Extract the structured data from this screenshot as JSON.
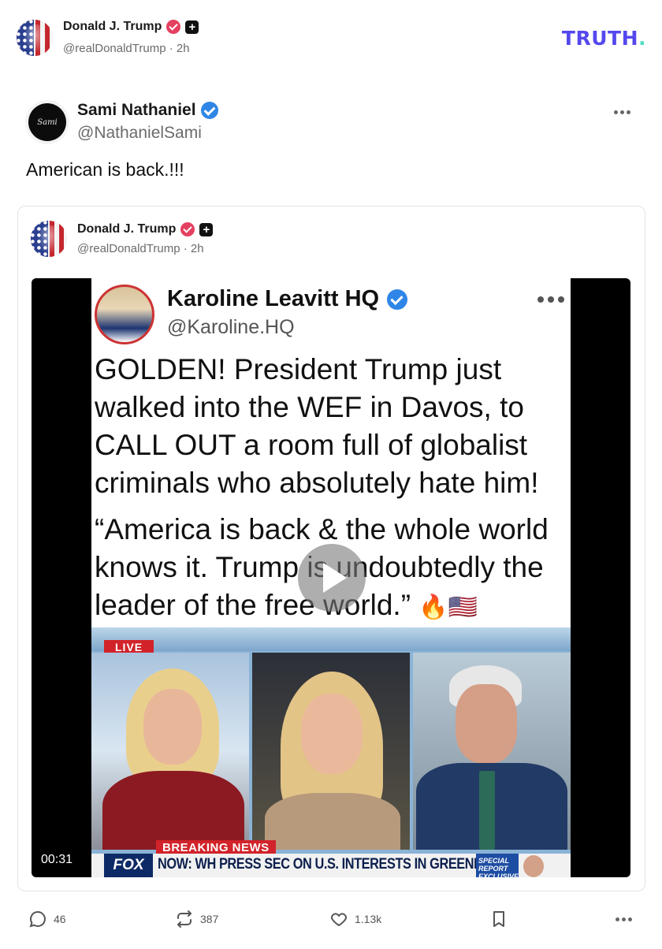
{
  "repost_header": {
    "author_name": "Donald J. Trump",
    "handle": "@realDonaldTrump",
    "time": "2h"
  },
  "brand": {
    "logo_text": "TRUTH",
    "logo_dot": "."
  },
  "post": {
    "author_name": "Sami Nathaniel",
    "avatar_text": "Sami",
    "handle": "@NathanielSami",
    "text": "American is back.!!!"
  },
  "quoted_post": {
    "author_name": "Donald J. Trump",
    "handle": "@realDonaldTrump",
    "time": "2h",
    "video": {
      "duration": "00:31",
      "frame": {
        "account_name": "Karoline Leavitt HQ",
        "account_handle": "@Karoline.HQ",
        "body": "GOLDEN! President Trump just walked into the WEF in Davos, to CALL OUT a room full of globalist criminals who absolutely hate him!",
        "quote": "“America is back & the whole world knows it. Trump is undoubtedly the leader of the free world.”",
        "emoji": "🔥🇺🇸",
        "live_label": "LIVE",
        "breaking_label": "BREAKING NEWS",
        "network": "FOX",
        "ticker": "NOW: WH PRESS SEC ON U.S. INTERESTS IN GREENLAND",
        "special_label": "SPECIAL REPORT EXCLUSIVE"
      }
    }
  },
  "actions": {
    "replies": "46",
    "retruths": "387",
    "likes": "1.13k"
  },
  "colors": {
    "brand": "#5448ee",
    "brand_dot": "#4fe0c3",
    "verified_pink": "#e4405f",
    "verified_blue": "#2f86e6"
  }
}
